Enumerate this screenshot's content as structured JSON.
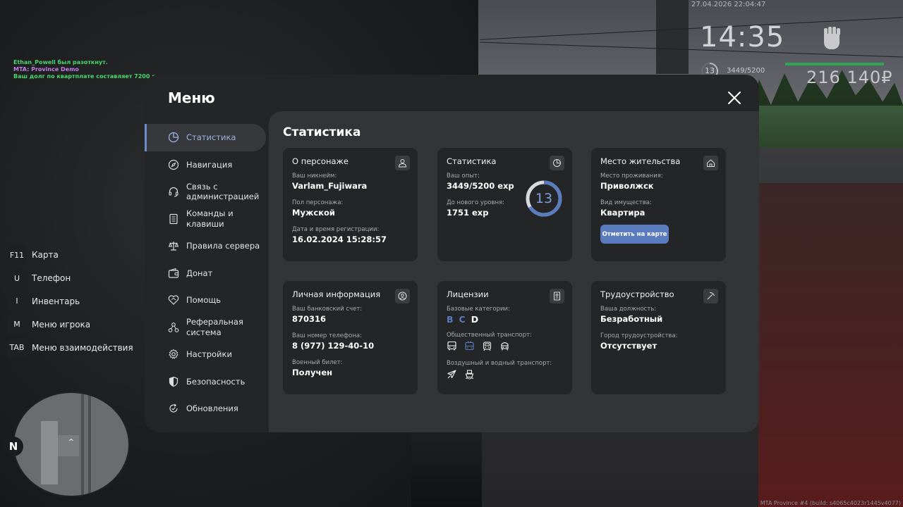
{
  "chat": {
    "line1": "Ethan_Powell был разоткнут.",
    "line2": "MTA: Province Demo",
    "line3": "Ваш долг по квартплате составляет 7200 р."
  },
  "hud": {
    "datetime": "27.04.2026 22:04:47",
    "time": "14:35",
    "level": "13",
    "exp": "3449/5200",
    "money": "216 140₽",
    "health_color": "#2fa654"
  },
  "hotkeys": [
    {
      "key": "F11",
      "label": "Карта"
    },
    {
      "key": "U",
      "label": "Телефон"
    },
    {
      "key": "I",
      "label": "Инвентарь"
    },
    {
      "key": "M",
      "label": "Меню игрока"
    },
    {
      "key": "TAB",
      "label": "Меню взаимодействия"
    }
  ],
  "minimap": {
    "north": "N"
  },
  "build_tag": "MTA Province #4 (build: s4065c4023r1445v4077)",
  "menu": {
    "title": "Меню",
    "close_icon": "close-icon",
    "nav": [
      {
        "label": "Статистика",
        "icon": "pie-chart-icon",
        "active": true
      },
      {
        "label": "Навигация",
        "icon": "compass-icon"
      },
      {
        "label": "Связь с администрацией",
        "icon": "headset-icon"
      },
      {
        "label": "Команды и клавиши",
        "icon": "document-icon"
      },
      {
        "label": "Правила сервера",
        "icon": "scales-icon"
      },
      {
        "label": "Донат",
        "icon": "wallet-icon"
      },
      {
        "label": "Помощь",
        "icon": "handshake-icon"
      },
      {
        "label": "Реферальная система",
        "icon": "network-icon"
      },
      {
        "label": "Настройки",
        "icon": "gear-icon"
      },
      {
        "label": "Безопасность",
        "icon": "shield-icon"
      },
      {
        "label": "Обновления",
        "icon": "refresh-icon"
      }
    ],
    "accent_color": "#5a7bbd"
  },
  "stats": {
    "title": "Статистика",
    "character": {
      "title": "О персонаже",
      "nickname_label": "Ваш никнейм:",
      "nickname": "Varlam_Fujiwara",
      "gender_label": "Пол персонажа:",
      "gender": "Мужской",
      "reg_label": "Дата и время регистрации:",
      "reg": "16.02.2024 15:28:57"
    },
    "statistics": {
      "title": "Статистика",
      "exp_label": "Ваш опыт:",
      "exp": "3449/5200 exp",
      "next_label": "До нового уровня:",
      "next": "1751 exp",
      "level": "13",
      "progress": 0.663
    },
    "residence": {
      "title": "Место жительства",
      "place_label": "Место проживания:",
      "place": "Приволжск",
      "property_label": "Вид имущества:",
      "property": "Квартира",
      "map_button": "Отметить на карте"
    },
    "personal": {
      "title": "Личная информация",
      "bank_label": "Ваш банковский счет:",
      "bank": "870316",
      "phone_label": "Ваш номер телефона:",
      "phone": "8 (977) 129-40-10",
      "military_label": "Военный билет:",
      "military": "Получен"
    },
    "licenses": {
      "title": "Лицензии",
      "base_label": "Базовые категории:",
      "cat_b": "B",
      "cat_c": "C",
      "cat_d": "D",
      "public_label": "Общественный транспорт:",
      "air_label": "Воздушный и водный транспорт:"
    },
    "employment": {
      "title": "Трудоустройство",
      "position_label": "Ваша должность:",
      "position": "Безработный",
      "city_label": "Город трудоустройства:",
      "city": "Отсутствует"
    }
  }
}
